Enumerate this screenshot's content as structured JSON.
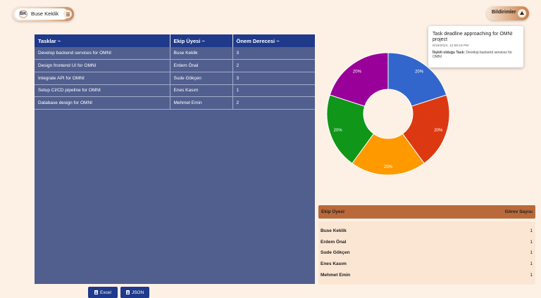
{
  "user": {
    "initials": "BK",
    "name": "Buse Keklik"
  },
  "notifications": {
    "label": "Bildirimler",
    "popup": {
      "title": "Task deadline approaching for OMNI project",
      "date": "8/16/2024, 12:59:19 PM",
      "related_label": "İlişkili olduğu Task:",
      "related_value": "Develop backend services for OMNI"
    }
  },
  "table": {
    "headers": [
      "Tasklar ~",
      "Ekip Üyesi ~",
      "Önem Derecesi ~"
    ],
    "rows": [
      [
        "Develop backend services for OMNI",
        "Buse Keklik",
        "3"
      ],
      [
        "Design frontend UI for OMNI",
        "Erdem Önal",
        "2"
      ],
      [
        "Integrate API for OMNI",
        "Sude Gökçen",
        "3"
      ],
      [
        "Setup CI/CD pipeline for OMNI",
        "Enes Kasım",
        "1"
      ],
      [
        "Database design for OMNI",
        "Mehmet Emin",
        "2"
      ]
    ]
  },
  "exports": {
    "excel": "Excel",
    "json": "JSON"
  },
  "chart_data": {
    "type": "pie",
    "donut": true,
    "labels": [
      "Buse Keklik",
      "Erdem Önal",
      "Sude Gökçen",
      "Enes Kasım",
      "Mehmet Emin"
    ],
    "values": [
      20,
      20,
      20,
      20,
      20
    ],
    "value_labels": [
      "20%",
      "20%",
      "20%",
      "20%",
      "20%"
    ],
    "colors": [
      "#3366cc",
      "#dc3912",
      "#ff9900",
      "#109618",
      "#990099"
    ]
  },
  "members": {
    "header_name": "Ekip Üyesi",
    "header_count": "Görev Sayısı",
    "rows": [
      {
        "name": "Buse Keklik",
        "count": "1"
      },
      {
        "name": "Erdem Önal",
        "count": "1"
      },
      {
        "name": "Sude Gökçen",
        "count": "1"
      },
      {
        "name": "Enes Kasım",
        "count": "1"
      },
      {
        "name": "Mehmet Emin",
        "count": "1"
      }
    ]
  }
}
